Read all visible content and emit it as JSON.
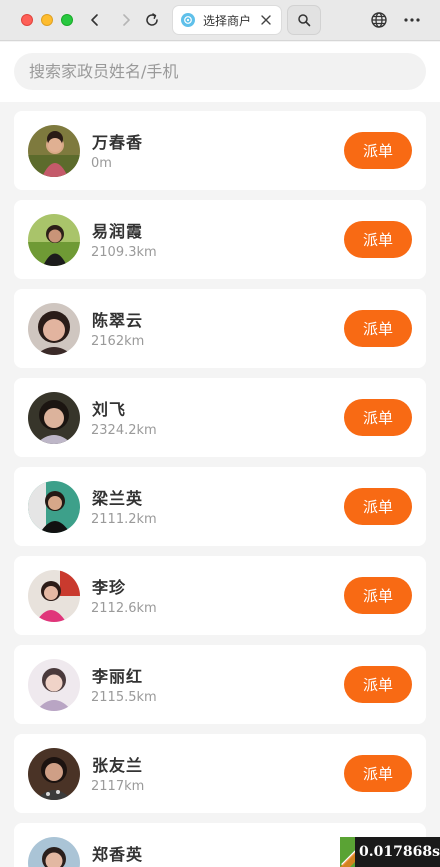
{
  "browser": {
    "tab_title": "选择商户"
  },
  "search": {
    "placeholder": "搜索家政员姓名/手机"
  },
  "workers": [
    {
      "name": "万春香",
      "distance": "0m",
      "button": "派单"
    },
    {
      "name": "易润霞",
      "distance": "2109.3km",
      "button": "派单"
    },
    {
      "name": "陈翠云",
      "distance": "2162km",
      "button": "派单"
    },
    {
      "name": "刘飞",
      "distance": "2324.2km",
      "button": "派单"
    },
    {
      "name": "梁兰英",
      "distance": "2111.2km",
      "button": "派单"
    },
    {
      "name": "李珍",
      "distance": "2112.6km",
      "button": "派单"
    },
    {
      "name": "李丽红",
      "distance": "2115.5km",
      "button": "派单"
    },
    {
      "name": "张友兰",
      "distance": "2117km",
      "button": "派单"
    },
    {
      "name": "郑香英",
      "distance": "",
      "button": ""
    }
  ],
  "timer": {
    "value": "0.017868s"
  },
  "colors": {
    "accent": "#f86a14",
    "background": "#f4f4f4"
  }
}
